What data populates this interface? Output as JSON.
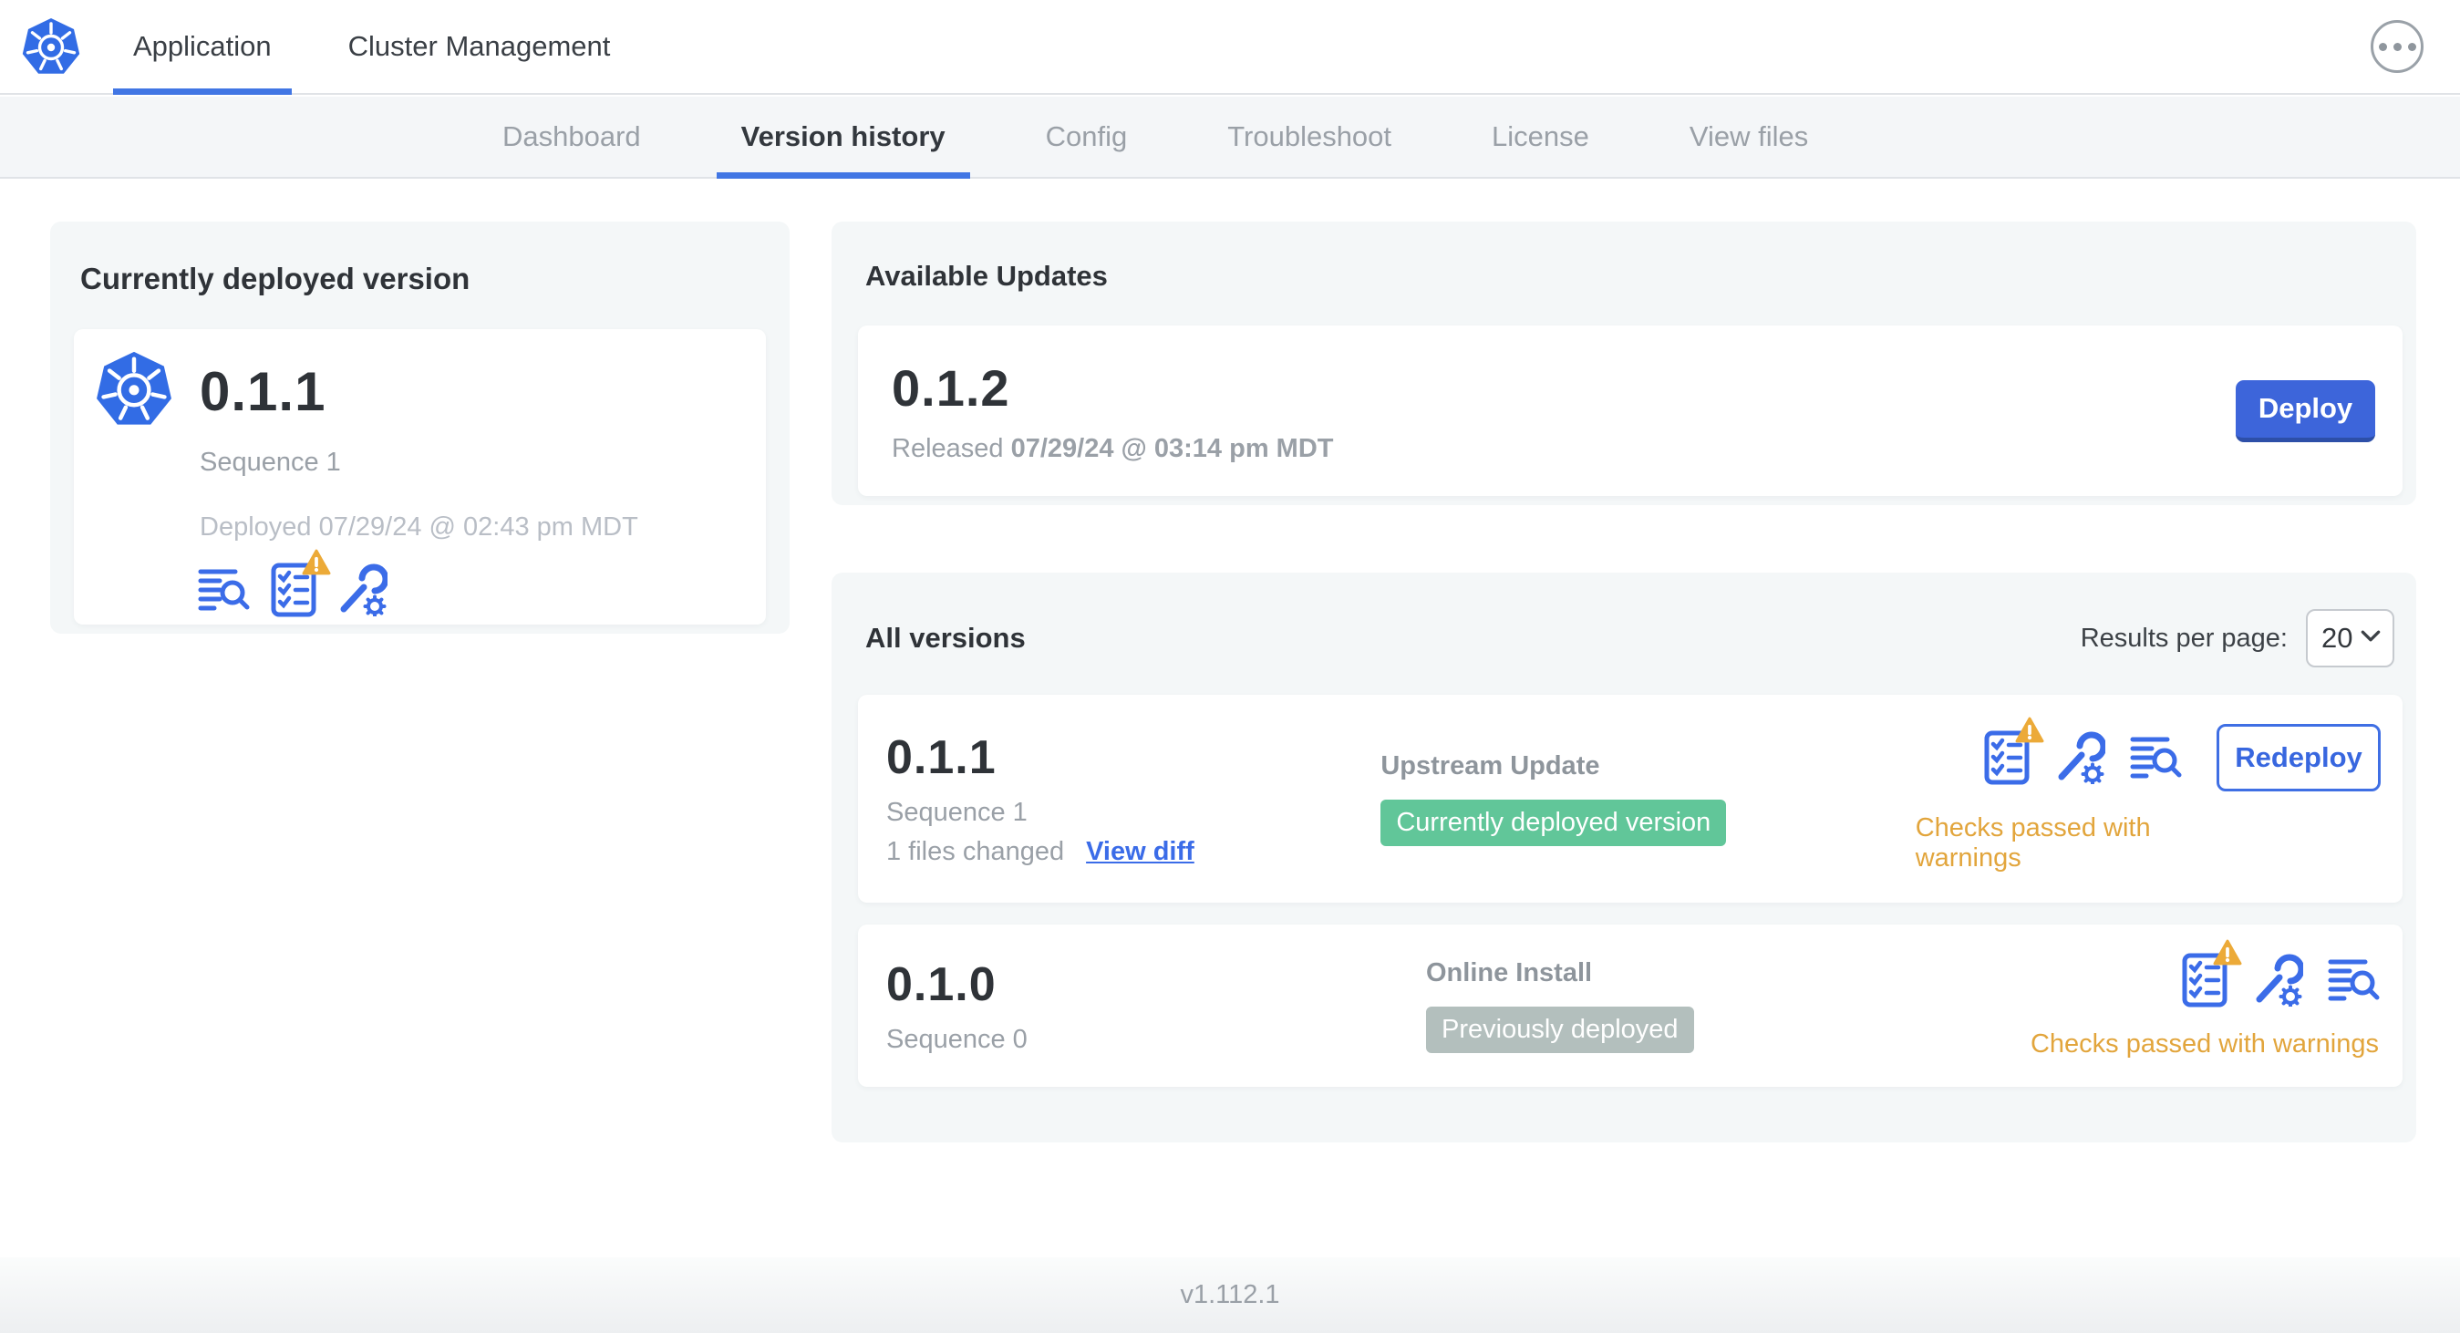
{
  "colors": {
    "kubernetes_blue": "#326ce5",
    "accent_blue": "#3b6ce8",
    "button_blue": "#3d65da",
    "tab_underline_blue": "#4176e4",
    "badge_green": "#61c699",
    "badge_gray": "#b3bfbd",
    "warning_amber": "#e3a53c"
  },
  "icons": {
    "logo": "kubernetes-logo",
    "menu": "ellipsis-menu-icon",
    "release_notes": "release-notes-icon",
    "preflight": "preflight-checks-icon",
    "config": "edit-config-icon",
    "warning": "warning-triangle-icon",
    "chevron": "chevron-down-icon"
  },
  "header": {
    "tabs": [
      {
        "label": "Application",
        "active": true
      },
      {
        "label": "Cluster Management",
        "active": false
      }
    ]
  },
  "subnav": {
    "tabs": [
      "Dashboard",
      "Version history",
      "Config",
      "Troubleshoot",
      "License",
      "View files"
    ],
    "active": "Version history"
  },
  "current": {
    "title": "Currently deployed version",
    "version": "0.1.1",
    "sequence": "Sequence 1",
    "deployed": "Deployed 07/29/24 @ 02:43 pm MDT"
  },
  "updates": {
    "title": "Available Updates",
    "version": "0.1.2",
    "released_prefix": "Released",
    "released_date": "07/29/24 @ 03:14 pm MDT",
    "deploy_label": "Deploy"
  },
  "allv": {
    "title": "All versions",
    "pager_label": "Results per page:",
    "pager_value": "20",
    "rows": [
      {
        "version": "0.1.1",
        "sequence": "Sequence 1",
        "files_changed": "1 files changed",
        "view_diff_label": "View diff",
        "source": "Upstream Update",
        "badge": "Currently deployed version",
        "badge_color": "#61c699",
        "action_label": "Redeploy",
        "status": "Checks passed with warnings"
      },
      {
        "version": "0.1.0",
        "sequence": "Sequence 0",
        "source": "Online Install",
        "badge": "Previously deployed",
        "badge_color": "#b3bfbd",
        "status": "Checks passed with warnings"
      }
    ]
  },
  "footer": {
    "version": "v1.112.1"
  }
}
